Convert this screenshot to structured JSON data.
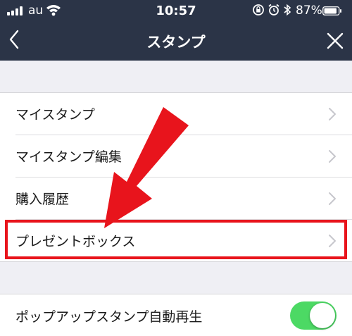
{
  "status_bar": {
    "carrier": "au",
    "time": "10:57",
    "battery": "87%",
    "icons": [
      "signal-icon",
      "wifi-icon",
      "rotation-lock-icon",
      "alarm-icon",
      "bluetooth-icon",
      "battery-icon"
    ]
  },
  "header": {
    "title": "スタンプ",
    "back_icon": "chevron-left-icon",
    "close_icon": "close-icon"
  },
  "menu": {
    "items": [
      {
        "label": "マイスタンプ",
        "icon": "chevron-right-icon"
      },
      {
        "label": "マイスタンプ編集",
        "icon": "chevron-right-icon"
      },
      {
        "label": "購入履歴",
        "icon": "chevron-right-icon"
      },
      {
        "label": "プレゼントボックス",
        "icon": "chevron-right-icon",
        "highlighted": true
      }
    ]
  },
  "settings": {
    "autoplay_label": "ポップアップスタンプ自動再生",
    "autoplay_on": true
  },
  "colors": {
    "header_bg": "#2b3447",
    "page_bg": "#efeff4",
    "toggle_on": "#4cd964",
    "highlight": "#e8141c"
  }
}
